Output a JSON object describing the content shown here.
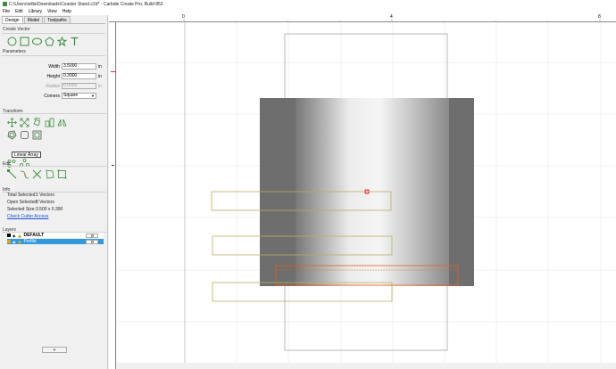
{
  "window": {
    "title": "C:\\Users\\willa\\Downloads\\Coaster Stand.c2d* - Carbide Create Pro, Build 853"
  },
  "menu": {
    "items": [
      "File",
      "Edit",
      "Library",
      "View",
      "Help"
    ]
  },
  "tabs": [
    {
      "label": "Design"
    },
    {
      "label": "Model"
    },
    {
      "label": "Toolpaths"
    }
  ],
  "sections": {
    "create_vector": "Create Vector",
    "parameters": "Parameters",
    "transform": "Transform",
    "edit": "Edit",
    "info": "Info",
    "layers": "Layers"
  },
  "parameters": {
    "width": {
      "label": "Width",
      "value": "3.5000",
      "unit": "in"
    },
    "height": {
      "label": "Height",
      "value": "0.3900",
      "unit": "in"
    },
    "radius": {
      "label": "Radius",
      "value": "0.0500",
      "unit": "in"
    },
    "corners": {
      "label": "Corners",
      "value": "Square"
    }
  },
  "tooltip": {
    "text": "Linear Array"
  },
  "info": {
    "total_selected_label": "Total Selected:",
    "total_selected_value": "1 Vectors",
    "open_selected_label": "Open Selected:",
    "open_selected_value": "0 Vectors",
    "selected_size_label": "Selected Size:",
    "selected_size_value": "3.500 x 0.390",
    "check_link": "Check Cutter Access"
  },
  "layers": [
    {
      "name": "DEFAULT",
      "color": "#000000",
      "selected": false
    },
    {
      "name": "Profile",
      "color": "#e8a020",
      "selected": true
    }
  ],
  "add_layer_label": "+",
  "ruler": {
    "labels": [
      "0",
      "4",
      "8"
    ]
  },
  "colors": {
    "accent_green": "#3a8d3a",
    "layer_select_blue": "#3399dd",
    "stock_dark": "#6e6e6e",
    "vector_olive": "#b5b061",
    "selected_orange": "#e8601c",
    "ruler_red": "#e03030"
  }
}
